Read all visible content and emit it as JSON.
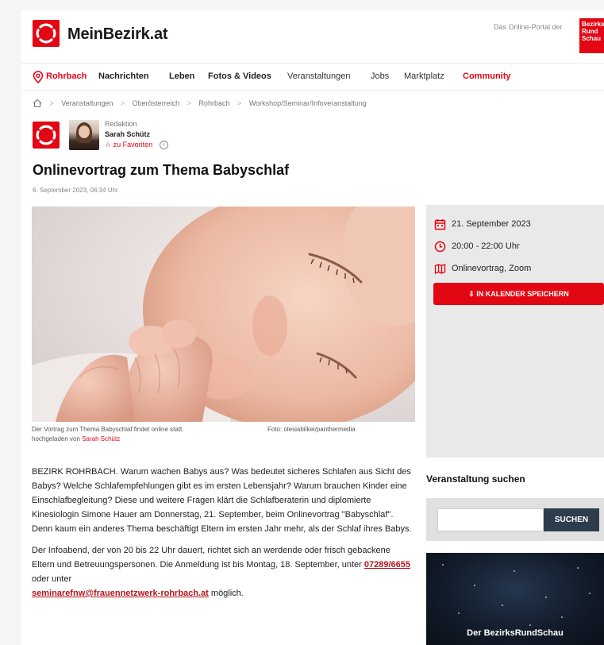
{
  "header": {
    "logo_text": "MeinBezirk.at",
    "portal_text": "Das Online-Portal der",
    "portal_logo_text": "Bezirks Rund Schau",
    "accent_color": "#e30613"
  },
  "nav": {
    "location": "Rohrbach",
    "items": [
      "Nachrichten",
      "Leben",
      "Fotos & Videos",
      "Veranstaltungen",
      "Jobs",
      "Marktplatz",
      "Community"
    ]
  },
  "breadcrumb": [
    "Veranstaltungen",
    "Oberösterreich",
    "Rohrbach",
    "Workshop/Seminar/Infoveranstaltung"
  ],
  "author": {
    "role": "Redaktion",
    "name": "Sarah Schütz",
    "favorite_label": "zu Favoriten"
  },
  "article": {
    "title": "Onlinevortrag zum Thema Babyschlaf",
    "date": "6. September 2023, 06:34 Uhr",
    "caption": "Der Vortrag zum Thema Babyschlaf findet online statt.",
    "photo_credit": "Foto: olesiabilkei/panthermedia",
    "uploaded_by_label": "hochgeladen von",
    "uploaded_by_name": "Sarah Schütz",
    "paragraph1": "BEZIRK ROHRBACH. Warum wachen Babys aus? Was bedeutet sicheres Schlafen aus Sicht des Babys? Welche Schlafempfehlungen gibt es im ersten Lebensjahr? Warum brauchen Kinder eine Einschlafbegleitung? Diese und weitere Fragen klärt die Schlafberaterin und diplomierte Kinesiologin Simone Hauer am Donnerstag, 21. September, beim Onlinevortrag \"Babyschlaf\". Denn kaum ein anderes Thema beschäftigt Eltern im ersten Jahr mehr, als der Schlaf ihres Babys.",
    "paragraph2_a": "Der Infoabend, der von 20 bis 22 Uhr dauert, richtet sich an werdende oder frisch gebackene Eltern und Betreuungspersonen. Die Anmeldung ist bis Montag, 18. September, unter ",
    "phone": "07289/6655",
    "paragraph2_b": " oder unter ",
    "email": "seminarefnw@frauennetzwerk-rohrbach.at",
    "paragraph2_c": " möglich."
  },
  "event": {
    "date": "21. September 2023",
    "time": "20:00 - 22:00 Uhr",
    "location": "Onlinevortrag, Zoom",
    "calendar_button": "IN KALENDER SPEICHERN"
  },
  "search": {
    "title": "Veranstaltung suchen",
    "button": "SUCHEN",
    "input_value": ""
  },
  "promo": {
    "text": "Der BezirksRundSchau"
  }
}
